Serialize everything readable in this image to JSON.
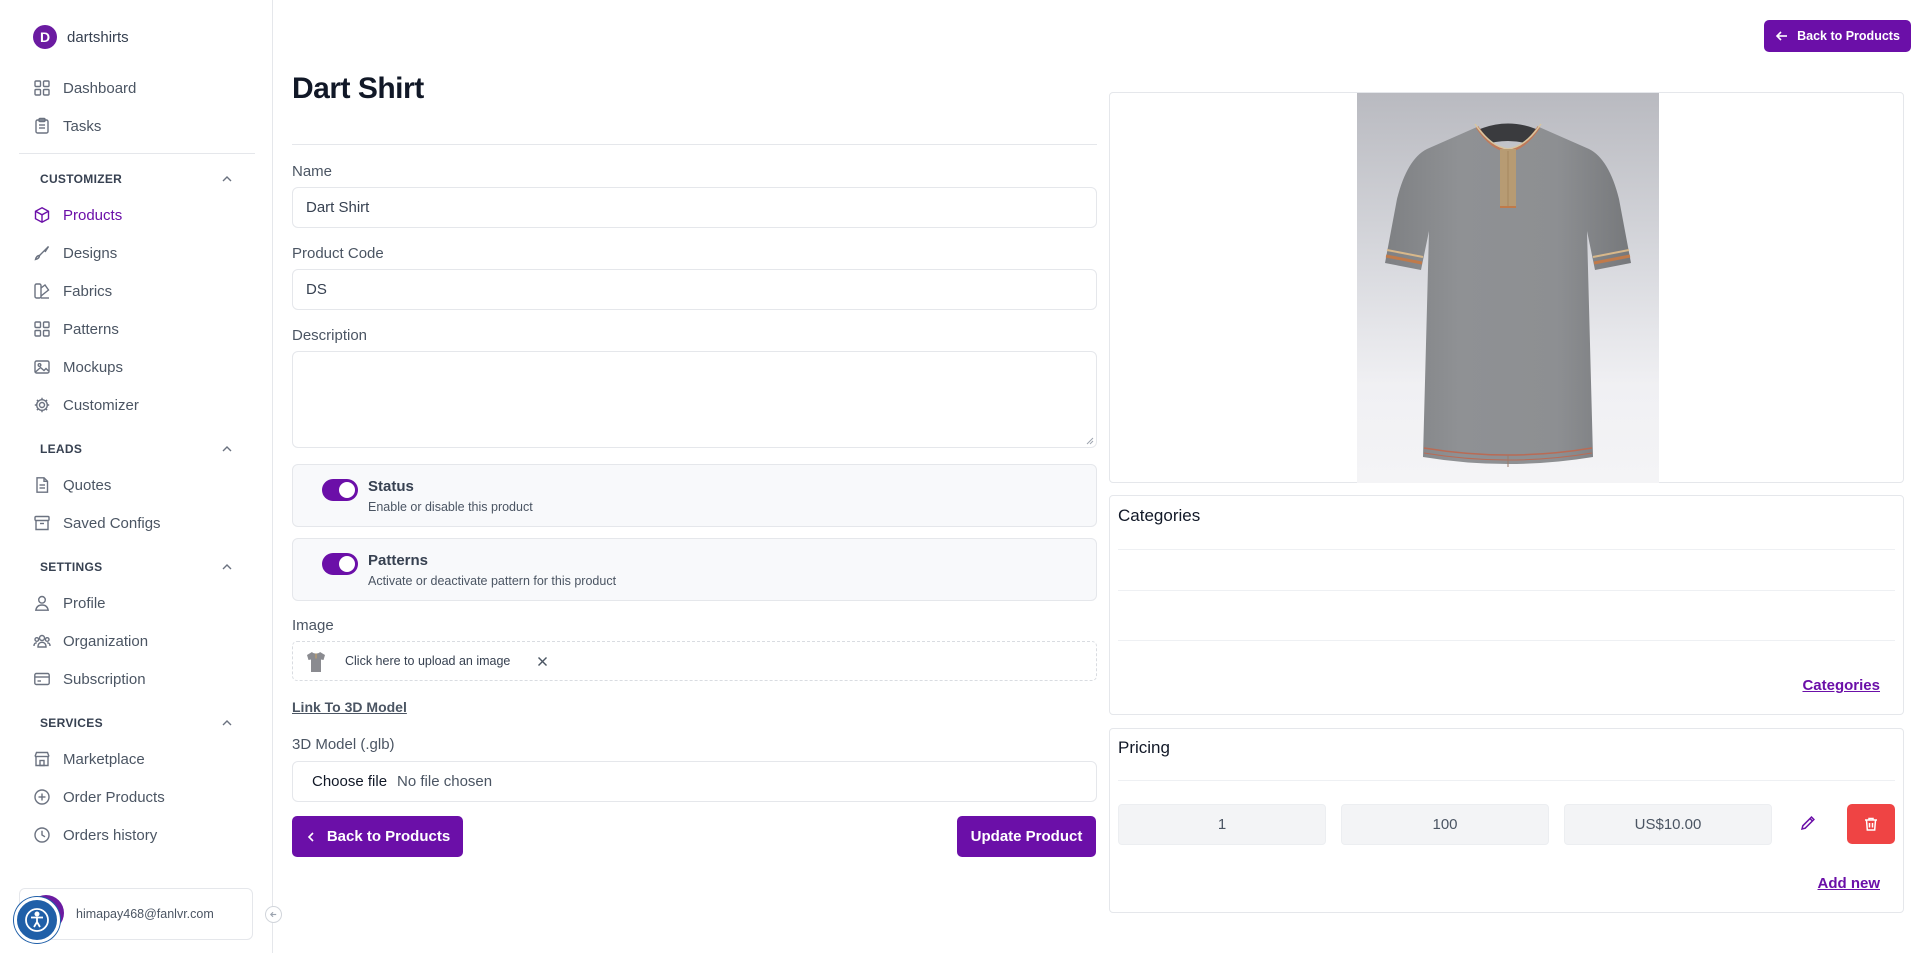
{
  "app": {
    "workspace_initial": "D",
    "workspace_name": "dartshirts"
  },
  "sidebar": {
    "top_items": [
      {
        "label": "Dashboard",
        "icon": "grid-icon"
      },
      {
        "label": "Tasks",
        "icon": "clipboard-icon"
      }
    ],
    "sections": [
      {
        "title": "CUSTOMIZER",
        "items": [
          "Products",
          "Designs",
          "Fabrics",
          "Patterns",
          "Mockups",
          "Customizer"
        ]
      },
      {
        "title": "LEADS",
        "items": [
          "Quotes",
          "Saved Configs"
        ]
      },
      {
        "title": "SETTINGS",
        "items": [
          "Profile",
          "Organization",
          "Subscription"
        ]
      },
      {
        "title": "SERVICES",
        "items": [
          "Marketplace",
          "Order Products",
          "Orders history"
        ]
      }
    ],
    "active_item": "Products",
    "user_email": "himapay468@fanlvr.com"
  },
  "header": {
    "back_button_label": "Back to Products"
  },
  "page": {
    "title": "Dart Shirt"
  },
  "form": {
    "name_label": "Name",
    "name_value": "Dart Shirt",
    "code_label": "Product Code",
    "code_value": "DS",
    "description_label": "Description",
    "description_value": "",
    "status": {
      "title": "Status",
      "subtitle": "Enable or disable this product",
      "enabled": true
    },
    "patterns": {
      "title": "Patterns",
      "subtitle": "Activate or deactivate pattern for this product",
      "enabled": true
    },
    "image_label": "Image",
    "image_upload_text": "Click here to upload an image",
    "link_3d_label": "Link To 3D Model",
    "model_label": "3D Model (.glb)",
    "model_choose": "Choose file",
    "model_none": "No file chosen",
    "back_button": "Back to Products",
    "update_button": "Update Product"
  },
  "categories": {
    "title": "Categories",
    "link": "Categories"
  },
  "pricing": {
    "title": "Pricing",
    "rows": [
      {
        "min": "1",
        "max": "100",
        "price": "US$10.00"
      }
    ],
    "add_new": "Add new"
  },
  "colors": {
    "accent": "#6b0fa8",
    "danger": "#ef4444",
    "a11y": "#1f5fa8"
  }
}
